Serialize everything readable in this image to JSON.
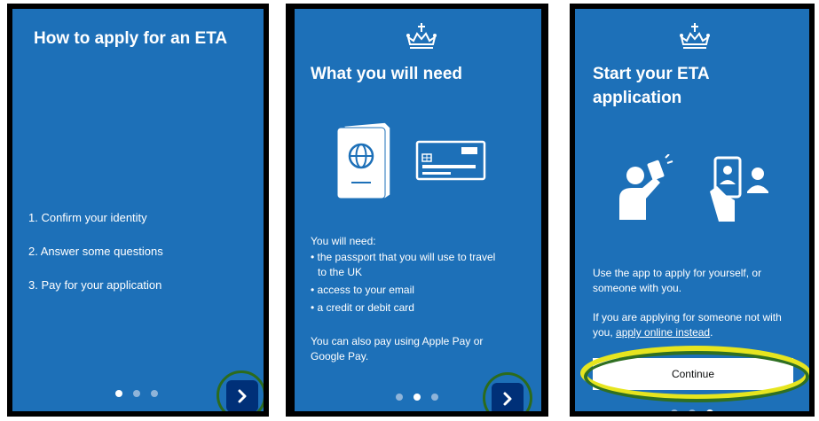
{
  "screens": [
    {
      "title": "How to apply for an ETA",
      "steps": [
        "1. Confirm your identity",
        "2. Answer some questions",
        "3. Pay for your application"
      ],
      "active_dot": 1
    },
    {
      "title": "What you will need",
      "intro": "You will need:",
      "bullets": [
        "• the passport that you will use to travel",
        "to the UK",
        "• access to your email",
        "• a credit or debit card"
      ],
      "footer": "You can also pay using Apple Pay or",
      "footer2": "Google Pay.",
      "active_dot": 2
    },
    {
      "title_line1": "Start your ETA",
      "title_line2": "application",
      "para1_line1": "Use the app to apply for yourself, or",
      "para1_line2": "someone with you.",
      "para2_line1": "If you are applying for someone not with",
      "para2_prefix": "you, ",
      "para2_link": "apply online instead",
      "para2_suffix": ".",
      "continue_label": "Continue",
      "active_dot": 3
    }
  ],
  "colors": {
    "panel_blue": "#1d70b8",
    "button_dark_blue": "#003078",
    "highlight_yellow": "#e6e51f",
    "highlight_green": "#2c6b1c"
  },
  "icons": {
    "crown": "crown-icon",
    "next": "chevron-right-icon",
    "passport": "passport-icon",
    "card": "credit-card-icon",
    "selfie": "selfie-icon",
    "phone_id": "phone-id-icon"
  }
}
